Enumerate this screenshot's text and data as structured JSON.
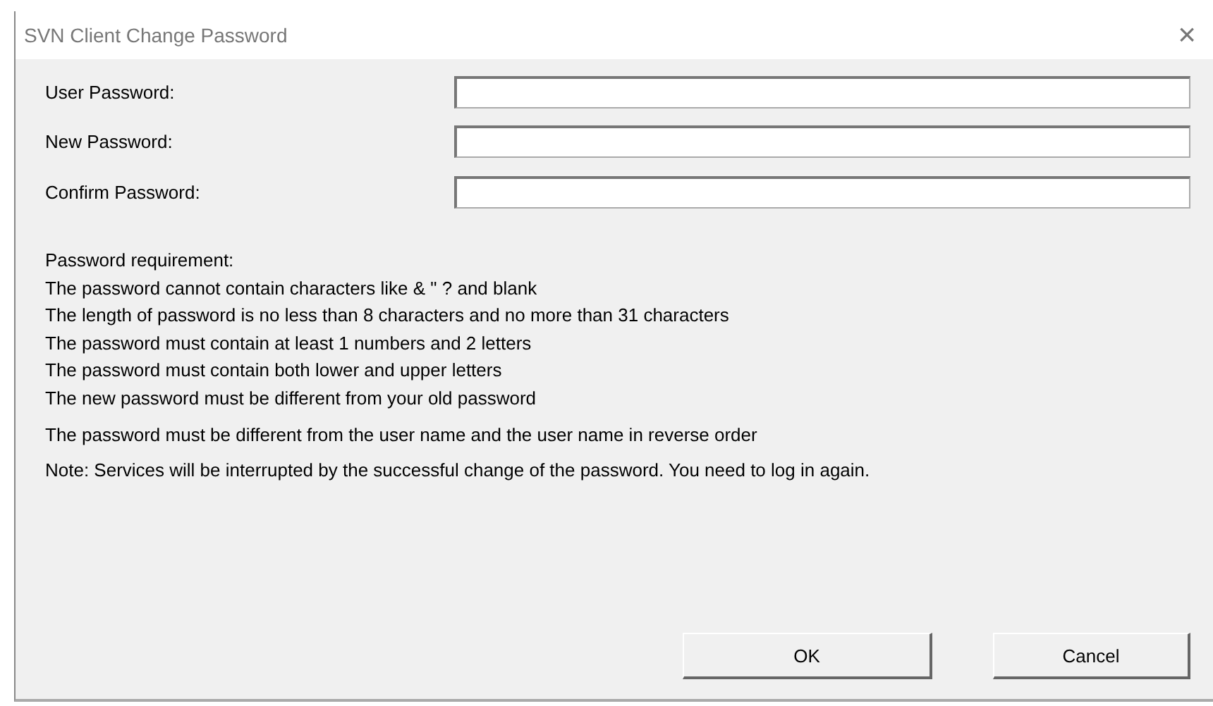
{
  "window": {
    "title": "SVN Client Change Password",
    "close": "×"
  },
  "fields": [
    {
      "label": "User Password:"
    },
    {
      "label": "New Password:"
    },
    {
      "label": "Confirm Password:"
    }
  ],
  "requirements": {
    "heading": "Password requirement:",
    "rules": [
      "The password cannot contain characters like & \" ? and blank",
      "The length of password is no less than 8 characters and no more than 31 characters",
      "The password must contain at least 1 numbers and 2 letters",
      "The password must contain both lower and upper letters",
      "The new password must be different from your old password"
    ],
    "extra_rule": "The password must be different from the user name and the user name in reverse order",
    "note": "Note: Services will be interrupted by the successful change of the password. You need to log in again."
  },
  "buttons": [
    "OK",
    "Cancel"
  ]
}
